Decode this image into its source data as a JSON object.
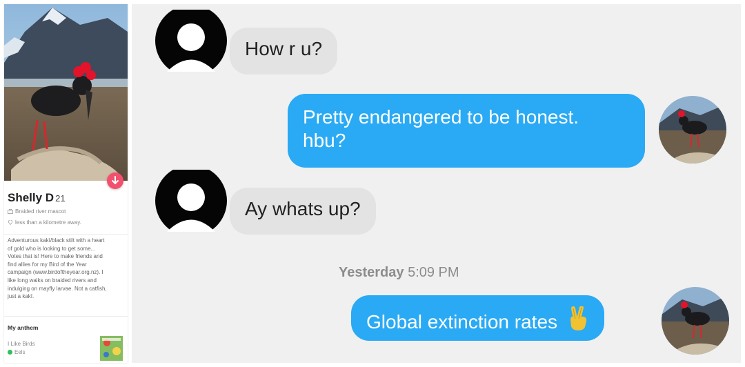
{
  "profile": {
    "name": "Shelly D",
    "age": "21",
    "job": "Braided river mascot",
    "distance": "less than a kilometre away.",
    "bio_lines": [
      "Adventurous kakī/black stilt with a heart",
      "of gold who is looking to get some...",
      "Votes that is! Here to make friends and",
      "find allies for my Bird of the Year",
      "campaign (www.birdoftheyear.org.nz). I",
      "like long walks on braided rivers and",
      "indulging on mayfly larvae. Not a catfish,",
      "just a kakī."
    ],
    "anthem_heading": "My anthem",
    "song_title": "I Like Birds",
    "song_artist": "Eels"
  },
  "chat": {
    "messages": [
      {
        "direction": "incoming",
        "text": "How r u?"
      },
      {
        "direction": "outgoing",
        "lines": [
          "Pretty endangered to be honest.",
          "hbu?"
        ]
      },
      {
        "direction": "incoming",
        "text": "Ay whats up?"
      },
      {
        "direction": "outgoing",
        "text": "Global extinction rates",
        "emoji": "victory-hand"
      }
    ],
    "timestamp_day": "Yesterday",
    "timestamp_time": "5:09 PM"
  },
  "colors": {
    "outgoing_bubble": "#2aaaf4",
    "incoming_bubble": "#e3e3e3",
    "chat_background": "#f0f0f0",
    "accent_pink": "#f2506e"
  },
  "icons": [
    "briefcase-icon",
    "location-pin-icon",
    "arrow-down-icon",
    "spotify-icon",
    "victory-hand-emoji"
  ]
}
